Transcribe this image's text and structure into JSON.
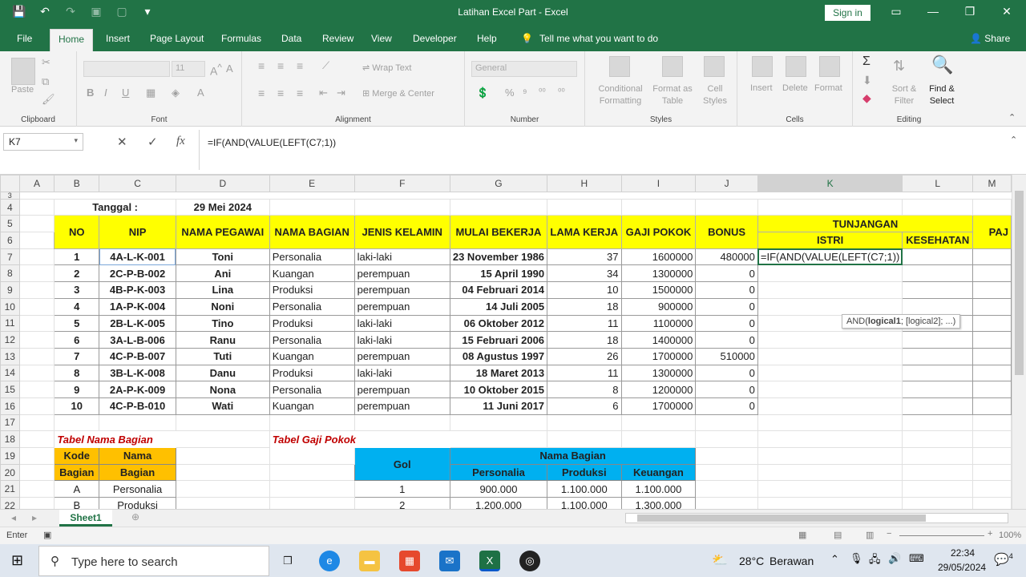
{
  "window": {
    "title": "Latihan Excel Part  -  Excel",
    "signin": "Sign in",
    "qat": [
      "💾",
      "↶",
      "↷",
      "▣",
      "▢",
      "▾"
    ],
    "controls": [
      "▭",
      "—",
      "❐",
      "✕"
    ]
  },
  "menu": {
    "tabs": [
      "File",
      "Home",
      "Insert",
      "Page Layout",
      "Formulas",
      "Data",
      "Review",
      "View",
      "Developer",
      "Help"
    ],
    "tell": "Tell me what you want to do",
    "share": "Share"
  },
  "ribbon": {
    "clipboard": {
      "label": "Clipboard",
      "paste": "Paste"
    },
    "font": {
      "label": "Font",
      "name": "",
      "size": "11",
      "buttons": [
        "B",
        "I",
        "U"
      ]
    },
    "alignment": {
      "label": "Alignment",
      "wrap": "Wrap Text",
      "merge": "Merge & Center"
    },
    "number": {
      "label": "Number",
      "format": "General"
    },
    "styles": {
      "label": "Styles",
      "items": [
        "Conditional Formatting",
        "Format as Table",
        "Cell Styles"
      ]
    },
    "cells": {
      "label": "Cells",
      "items": [
        "Insert",
        "Delete",
        "Format"
      ]
    },
    "editing": {
      "label": "Editing",
      "items": [
        "Sort & Filter",
        "Find & Select"
      ]
    }
  },
  "formula_bar": {
    "name_box": "K7",
    "fx": "fx",
    "formula": "=IF(AND(VALUE(LEFT(C7;1))"
  },
  "columns": [
    "A",
    "B",
    "C",
    "D",
    "E",
    "F",
    "G",
    "H",
    "I",
    "J",
    "K",
    "L",
    "M"
  ],
  "sheet": {
    "r4": {
      "row": "4",
      "tanggal_label": "Tanggal :",
      "tanggal": "29 Mei 2024"
    },
    "r5": {
      "row": "5",
      "headers": [
        "NO",
        "NIP",
        "NAMA PEGAWAI",
        "NAMA BAGIAN",
        "JENIS KELAMIN",
        "MULAI BEKERJA",
        "LAMA KERJA",
        "GAJI POKOK",
        "BONUS"
      ],
      "tunjangan": "TUNJANGAN",
      "paj": "PAJ"
    },
    "r6": {
      "row": "6",
      "istri": "ISTRI",
      "kesehatan": "KESEHATAN"
    },
    "editing_formula": "=IF(AND(VALUE(LEFT(C7;1))",
    "employees": [
      {
        "row": "7",
        "no": "1",
        "nip": "4A-L-K-001",
        "nama": "Toni",
        "bagian": "Personalia",
        "jk": "laki-laki",
        "mulai": "23 November 1986",
        "lama": "37",
        "gaji": "1600000",
        "bonus": "480000"
      },
      {
        "row": "8",
        "no": "2",
        "nip": "2C-P-B-002",
        "nama": "Ani",
        "bagian": "Kuangan",
        "jk": "perempuan",
        "mulai": "15 April 1990",
        "lama": "34",
        "gaji": "1300000",
        "bonus": "0"
      },
      {
        "row": "9",
        "no": "3",
        "nip": "4B-P-K-003",
        "nama": "Lina",
        "bagian": "Produksi",
        "jk": "perempuan",
        "mulai": "04 Februari 2014",
        "lama": "10",
        "gaji": "1500000",
        "bonus": "0"
      },
      {
        "row": "10",
        "no": "4",
        "nip": "1A-P-K-004",
        "nama": "Noni",
        "bagian": "Personalia",
        "jk": "perempuan",
        "mulai": "14 Juli 2005",
        "lama": "18",
        "gaji": "900000",
        "bonus": "0"
      },
      {
        "row": "11",
        "no": "5",
        "nip": "2B-L-K-005",
        "nama": "Tino",
        "bagian": "Produksi",
        "jk": "laki-laki",
        "mulai": "06 Oktober 2012",
        "lama": "11",
        "gaji": "1100000",
        "bonus": "0"
      },
      {
        "row": "12",
        "no": "6",
        "nip": "3A-L-B-006",
        "nama": "Ranu",
        "bagian": "Personalia",
        "jk": "laki-laki",
        "mulai": "15 Februari 2006",
        "lama": "18",
        "gaji": "1400000",
        "bonus": "0"
      },
      {
        "row": "13",
        "no": "7",
        "nip": "4C-P-B-007",
        "nama": "Tuti",
        "bagian": "Kuangan",
        "jk": "perempuan",
        "mulai": "08 Agustus 1997",
        "lama": "26",
        "gaji": "1700000",
        "bonus": "510000"
      },
      {
        "row": "14",
        "no": "8",
        "nip": "3B-L-K-008",
        "nama": "Danu",
        "bagian": "Produksi",
        "jk": "laki-laki",
        "mulai": "18 Maret 2013",
        "lama": "11",
        "gaji": "1300000",
        "bonus": "0"
      },
      {
        "row": "15",
        "no": "9",
        "nip": "2A-P-K-009",
        "nama": "Nona",
        "bagian": "Personalia",
        "jk": "perempuan",
        "mulai": "10 Oktober 2015",
        "lama": "8",
        "gaji": "1200000",
        "bonus": "0"
      },
      {
        "row": "16",
        "no": "10",
        "nip": "4C-P-B-010",
        "nama": "Wati",
        "bagian": "Kuangan",
        "jk": "perempuan",
        "mulai": "11 Juni 2017",
        "lama": "6",
        "gaji": "1700000",
        "bonus": "0"
      }
    ],
    "r17": {
      "row": "17"
    },
    "r18": {
      "row": "18",
      "t1": "Tabel Nama Bagian",
      "t2": "Tabel Gaji Pokok"
    },
    "r19": {
      "row": "19",
      "kode1": "Kode",
      "nama1": "Nama",
      "gol": "Gol",
      "nb": "Nama Bagian"
    },
    "r20": {
      "row": "20",
      "kode2": "Bagian",
      "nama2": "Bagian",
      "h": [
        "Personalia",
        "Produksi",
        "Keuangan"
      ]
    },
    "r21": {
      "row": "21",
      "kode": "A",
      "nama": "Personalia",
      "gol": "1",
      "v": [
        "900.000",
        "1.100.000",
        "1.100.000"
      ]
    },
    "r22": {
      "row": "22",
      "kode": "B",
      "nama": "Produksi",
      "gol": "2",
      "v": [
        "1.200.000",
        "1.100.000",
        "1.300.000"
      ]
    }
  },
  "tooltip": {
    "fn": "AND(",
    "arg1": "logical1",
    "rest": "; [logical2]; ...)"
  },
  "sheet_tab": "Sheet1",
  "status": {
    "mode": "Enter",
    "zoom": "100%"
  },
  "taskbar": {
    "search": "Type here to search",
    "temp": "28°C",
    "weather": "Berawan",
    "time": "22:34",
    "date": "29/05/2024",
    "notif": "4"
  }
}
